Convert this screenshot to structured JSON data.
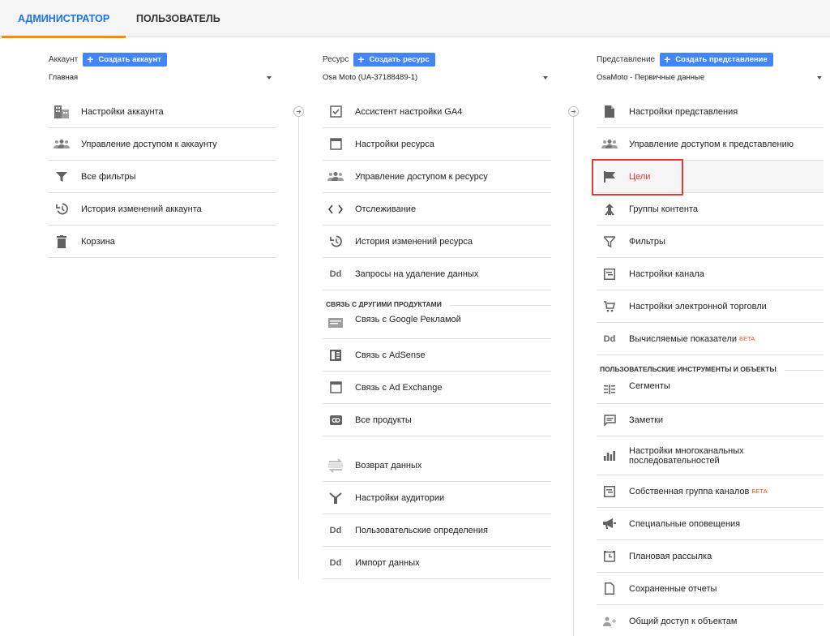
{
  "tabs": [
    {
      "label": "АДМИНИСТРАТОР",
      "active": true
    },
    {
      "label": "ПОЛЬЗОВАТЕЛЬ",
      "active": false
    }
  ],
  "account": {
    "title": "Аккаунт",
    "create_label": "Создать аккаунт",
    "selected": "Главная",
    "items": [
      {
        "label": "Настройки аккаунта",
        "icon": "building-icon"
      },
      {
        "label": "Управление доступом к аккаунту",
        "icon": "people-icon"
      },
      {
        "label": "Все фильтры",
        "icon": "filter-icon"
      },
      {
        "label": "История изменений аккаунта",
        "icon": "history-icon"
      },
      {
        "label": "Корзина",
        "icon": "trash-icon"
      }
    ]
  },
  "property": {
    "title": "Ресурс",
    "create_label": "Создать ресурс",
    "selected": "Osa Moto (UA-37188489-1)",
    "items": [
      {
        "label": "Ассистент настройки GA4",
        "icon": "checkbox-icon"
      },
      {
        "label": "Настройки ресурса",
        "icon": "window-icon"
      },
      {
        "label": "Управление доступом к ресурсу",
        "icon": "people-icon"
      },
      {
        "label": "Отслеживание",
        "icon": "code-icon"
      },
      {
        "label": "История изменений ресурса",
        "icon": "history-icon"
      },
      {
        "label": "Запросы на удаление данных",
        "icon": "dd-icon"
      }
    ],
    "section_label": "СВЯЗЬ С ДРУГИМИ ПРОДУКТАМИ",
    "links": [
      {
        "label": "Связь с Google Рекламой",
        "icon": "ads-icon"
      },
      {
        "label": "Связь с AdSense",
        "icon": "adsense-icon"
      },
      {
        "label": "Связь с Ad Exchange",
        "icon": "window-icon"
      },
      {
        "label": "Все продукты",
        "icon": "link-icon"
      }
    ],
    "extra": [
      {
        "label": "Возврат данных",
        "icon": "data-return-icon"
      },
      {
        "label": "Настройки аудитории",
        "icon": "audience-icon"
      },
      {
        "label": "Пользовательские определения",
        "icon": "dd-icon"
      },
      {
        "label": "Импорт данных",
        "icon": "dd-icon"
      }
    ]
  },
  "view": {
    "title": "Представление",
    "create_label": "Создать представление",
    "selected": "OsaMoto - Первичные данные",
    "items": [
      {
        "label": "Настройки представления",
        "icon": "document-icon"
      },
      {
        "label": "Управление доступом к представлению",
        "icon": "people-icon"
      },
      {
        "label": "Цели",
        "icon": "flag-icon"
      },
      {
        "label": "Группы контента",
        "icon": "content-groups-icon"
      },
      {
        "label": "Фильтры",
        "icon": "filter-icon"
      },
      {
        "label": "Настройки канала",
        "icon": "channel-icon"
      },
      {
        "label": "Настройки электронной торговли",
        "icon": "cart-icon"
      },
      {
        "label": "Вычисляемые показатели",
        "icon": "dd-icon",
        "beta": "БЕТА"
      }
    ],
    "section_label": "ПОЛЬЗОВАТЕЛЬСКИЕ ИНСТРУМЕНТЫ И ОБЪЕКТЫ",
    "tools": [
      {
        "label": "Сегменты",
        "icon": "segments-icon"
      },
      {
        "label": "Заметки",
        "icon": "notes-icon"
      },
      {
        "label_line1": "Настройки многоканальных",
        "label_line2": "последовательностей",
        "icon": "bar-chart-icon"
      },
      {
        "label": "Собственная группа каналов",
        "icon": "channel-icon",
        "beta": "БЕТА"
      },
      {
        "label": "Специальные оповещения",
        "icon": "megaphone-icon"
      },
      {
        "label": "Плановая рассылка",
        "icon": "clock-icon"
      },
      {
        "label": "Сохраненные отчеты",
        "icon": "report-icon"
      },
      {
        "label": "Общий доступ к объектам",
        "icon": "share-icon"
      }
    ]
  },
  "colors": {
    "accent_blue": "#4285f4",
    "tab_underline": "#fb8c00",
    "beta": "#f4511e",
    "highlight_box": "#e53935"
  }
}
